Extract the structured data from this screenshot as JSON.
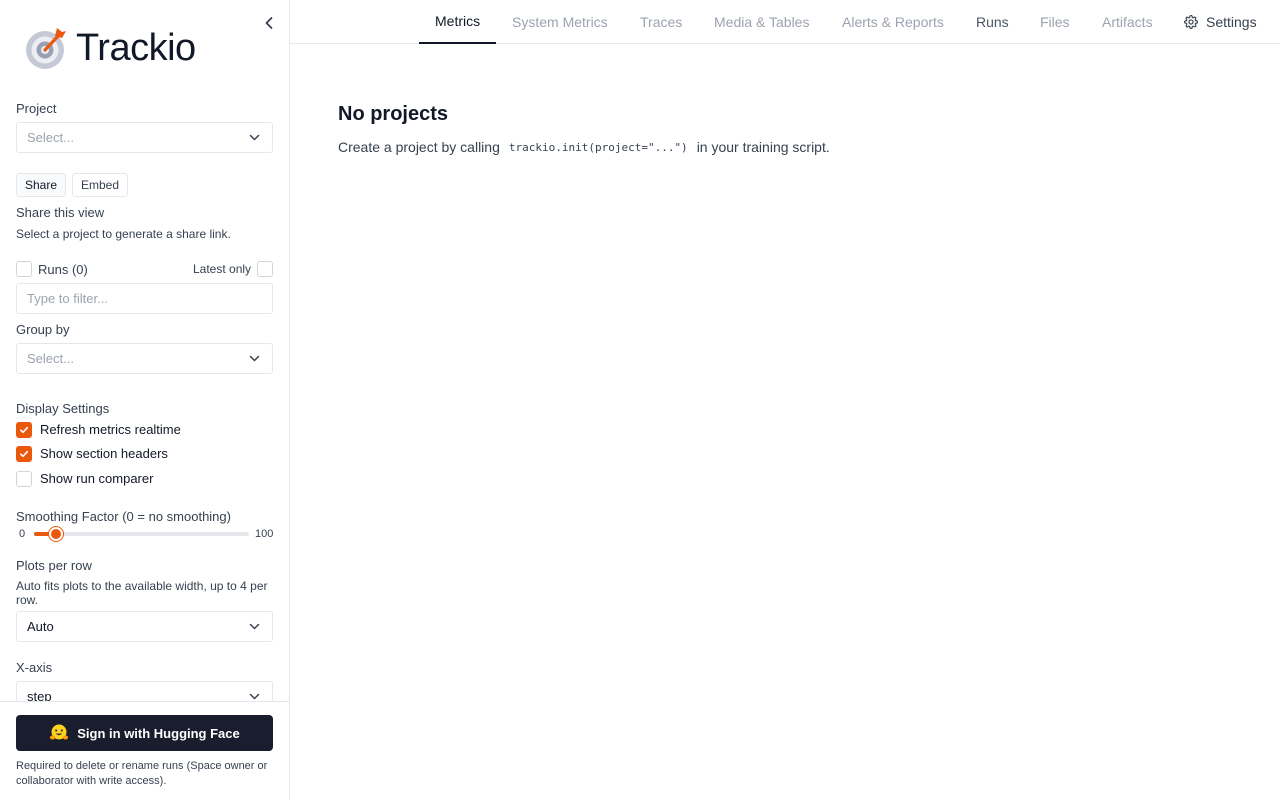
{
  "app": {
    "name": "Trackio"
  },
  "colors": {
    "accent": "#ea580c",
    "signin_bg": "#1a1d2e"
  },
  "sidebar": {
    "project_label": "Project",
    "project_placeholder": "Select...",
    "share_tab": "Share",
    "embed_tab": "Embed",
    "share_title": "Share this view",
    "share_desc": "Select a project to generate a share link.",
    "runs_label": "Runs (0)",
    "latest_only": "Latest only",
    "filter_placeholder": "Type to filter...",
    "group_by_label": "Group by",
    "group_by_placeholder": "Select...",
    "display_settings": "Display Settings",
    "options": [
      {
        "label": "Refresh metrics realtime",
        "checked": true
      },
      {
        "label": "Show section headers",
        "checked": true
      },
      {
        "label": "Show run comparer",
        "checked": false
      }
    ],
    "smoothing_label": "Smoothing Factor (0 = no smoothing)",
    "smoothing": {
      "min": "0",
      "max": "100",
      "value": 10
    },
    "plots_label": "Plots per row",
    "plots_desc": "Auto fits plots to the available width, up to 4 per row.",
    "plots_value": "Auto",
    "xaxis_label": "X-axis",
    "xaxis_value": "step",
    "signin_label": "Sign in with Hugging Face",
    "signin_icon": "hugging-face-emoji",
    "signin_note": "Required to delete or rename runs (Space owner or collaborator with write access)."
  },
  "nav": {
    "tabs": [
      {
        "label": "Metrics",
        "state": "active"
      },
      {
        "label": "System Metrics",
        "state": "disabled"
      },
      {
        "label": "Traces",
        "state": "disabled"
      },
      {
        "label": "Media & Tables",
        "state": "disabled"
      },
      {
        "label": "Alerts & Reports",
        "state": "disabled"
      },
      {
        "label": "Runs",
        "state": "enabled"
      },
      {
        "label": "Files",
        "state": "disabled"
      },
      {
        "label": "Artifacts",
        "state": "disabled"
      }
    ],
    "settings": "Settings"
  },
  "main": {
    "title": "No projects",
    "desc_before": "Create a project by calling",
    "desc_code": "trackio.init(project=\"...\")",
    "desc_after": "in your training script."
  }
}
